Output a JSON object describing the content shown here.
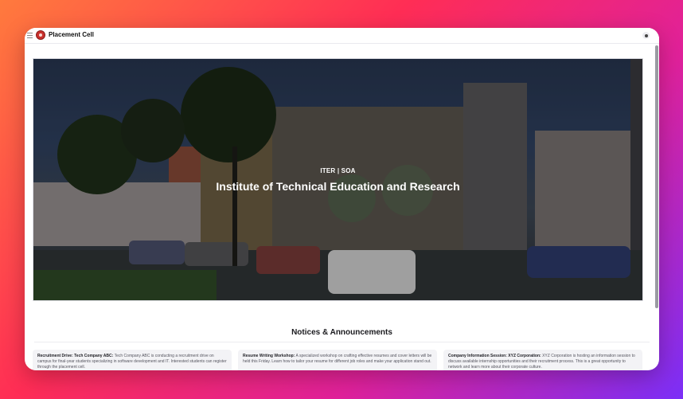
{
  "app": {
    "title": "Placement Cell"
  },
  "icons": {
    "menu": "menu-icon",
    "logo": "institute-logo",
    "user": "user-icon"
  },
  "hero": {
    "kicker": "ITER | SOA",
    "title": "Institute of Technical Education and Research"
  },
  "notices": {
    "heading": "Notices & Announcements",
    "items": [
      {
        "title": "Recruitment Drive: Tech Company ABC:",
        "body": "Tech Company ABC is conducting a recruitment drive on campus for final-year students specializing in software development and IT. Interested students can register through the placement cell."
      },
      {
        "title": "Resume Writing Workshop:",
        "body": "A specialized workshop on crafting effective resumes and cover letters will be held this Friday. Learn how to tailor your resume for different job roles and make your application stand out."
      },
      {
        "title": "Company Information Session: XYZ Corporation:",
        "body": "XYZ Corporation is hosting an information session to discuss available internship opportunities and their recruitment process. This is a great opportunity to network and learn more about their corporate culture."
      }
    ]
  }
}
